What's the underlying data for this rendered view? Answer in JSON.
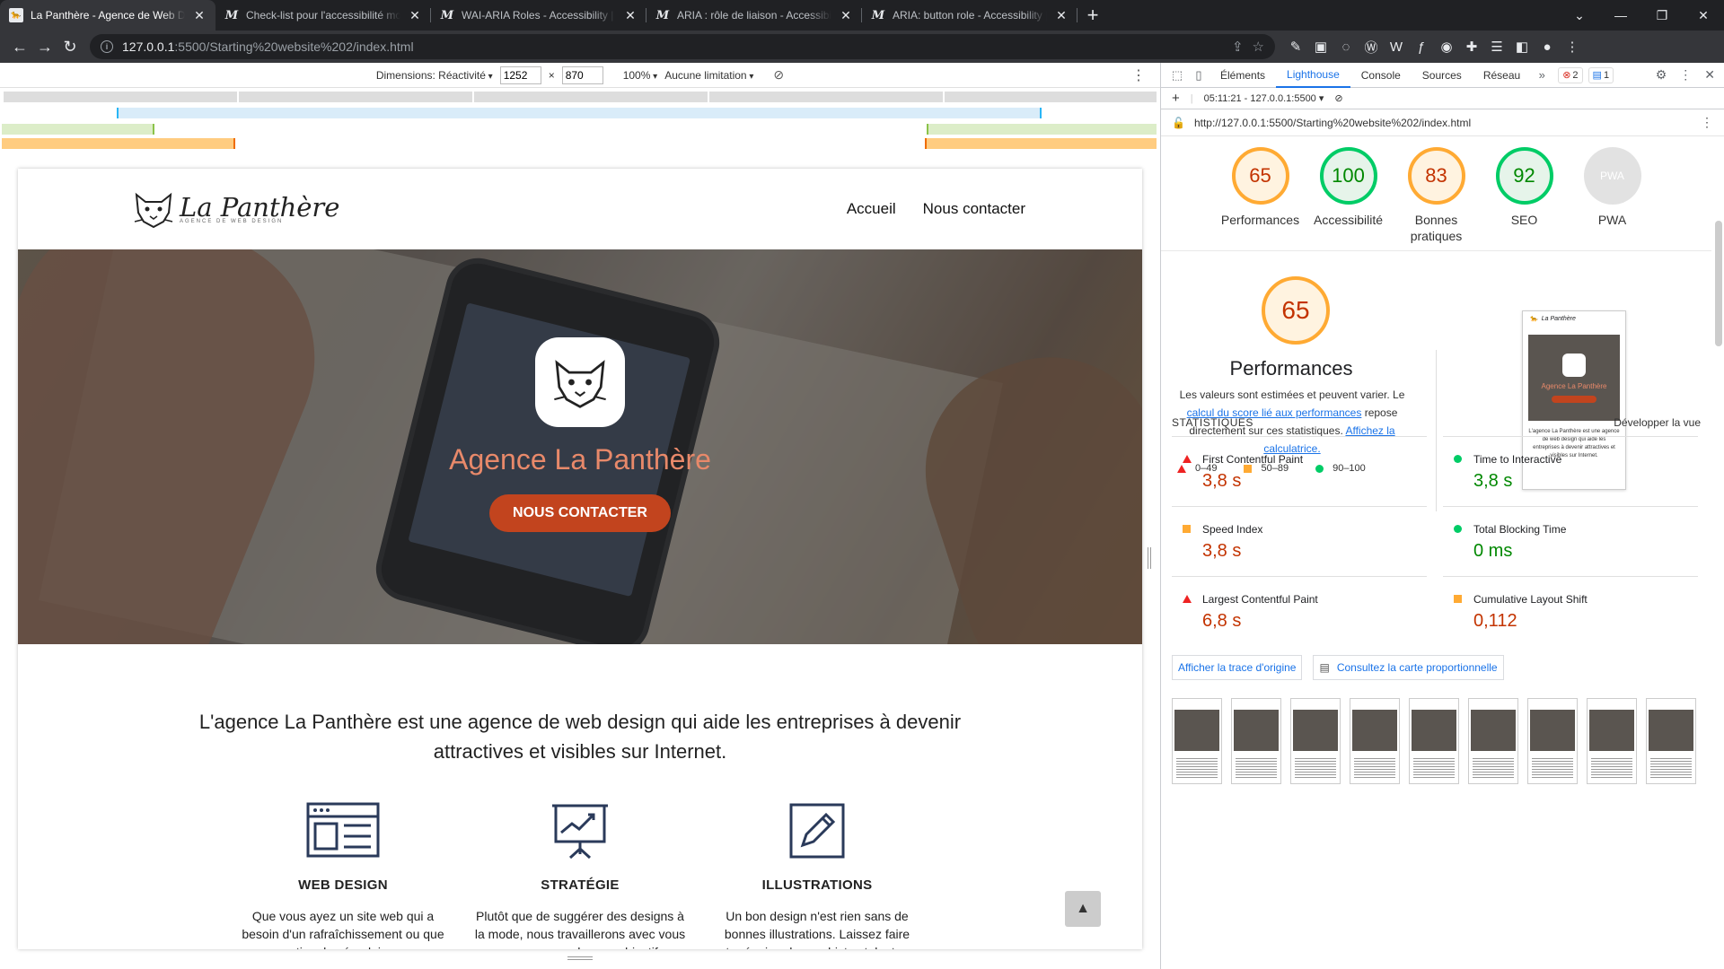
{
  "tabs": [
    {
      "title": "La Panthère - Agence de Web Design",
      "active": true
    },
    {
      "title": "Check-list pour l'accessibilité mobile"
    },
    {
      "title": "WAI-ARIA Roles - Accessibility | MDN"
    },
    {
      "title": "ARIA : rôle de liaison - Accessibilité"
    },
    {
      "title": "ARIA: button role - Accessibility | MDN"
    }
  ],
  "address": {
    "host": "127.0.0.1",
    "path": ":5500/Starting%20website%202/index.html"
  },
  "device_toolbar": {
    "dimensions_label": "Dimensions: Réactivité",
    "width": "1252",
    "times": "×",
    "height": "870",
    "zoom": "100%",
    "throttle": "Aucune limitation"
  },
  "site": {
    "logo_name": "La Panthère",
    "logo_sub": "AGENCE DE WEB DESIGN",
    "nav": [
      "Accueil",
      "Nous contacter"
    ],
    "hero_title": "Agence La Panthère",
    "hero_cta": "NOUS CONTACTER",
    "intro": "L'agence La Panthère est une agence de web design qui aide les entreprises à devenir attractives et visibles sur Internet.",
    "services": [
      {
        "title": "WEB DESIGN",
        "text": "Que vous ayez un site web qui a besoin d'un rafraîchissement ou que vous partiez de zéro, laissez-nous"
      },
      {
        "title": "STRATÉGIE",
        "text": "Plutôt que de suggérer des designs à la mode, nous travaillerons avec vous pour comprendre vos objectifs"
      },
      {
        "title": "ILLUSTRATIONS",
        "text": "Un bon design n'est rien sans de bonnes illustrations. Laissez faire notre équipe de graphistes talentueux"
      }
    ]
  },
  "devtools": {
    "tabs": [
      "Éléments",
      "Lighthouse",
      "Console",
      "Sources",
      "Réseau"
    ],
    "active_tab": "Lighthouse",
    "errors": "2",
    "messages": "1",
    "report_time": "05:11:21 - 127.0.0.1:5500",
    "report_url": "http://127.0.0.1:5500/Starting%20website%202/index.html"
  },
  "lighthouse": {
    "scores": [
      {
        "label": "Performances",
        "value": "65",
        "status": "orange"
      },
      {
        "label": "Accessibilité",
        "value": "100",
        "status": "green"
      },
      {
        "label": "Bonnes pratiques",
        "value": "83",
        "status": "orange"
      },
      {
        "label": "SEO",
        "value": "92",
        "status": "green"
      },
      {
        "label": "PWA",
        "value": "",
        "status": "gray"
      }
    ],
    "perf_score": "65",
    "perf_title": "Performances",
    "perf_desc_1": "Les valeurs sont estimées et peuvent varier. Le ",
    "perf_link_1": "calcul du score lié aux performances",
    "perf_desc_2": " repose directement sur ces statistiques. ",
    "perf_link_2": "Affichez la calculatrice.",
    "legend": [
      "0–49",
      "50–89",
      "90–100"
    ],
    "stats_heading": "STATISTIQUES",
    "expand": "Développer la vue",
    "metrics": [
      {
        "name": "First Contentful Paint",
        "value": "3,8 s",
        "status": "red"
      },
      {
        "name": "Time to Interactive",
        "value": "3,8 s",
        "status": "green"
      },
      {
        "name": "Speed Index",
        "value": "3,8 s",
        "status": "orange"
      },
      {
        "name": "Total Blocking Time",
        "value": "0 ms",
        "status": "green"
      },
      {
        "name": "Largest Contentful Paint",
        "value": "6,8 s",
        "status": "red"
      },
      {
        "name": "Cumulative Layout Shift",
        "value": "0,112",
        "status": "orange"
      }
    ],
    "btn_trace": "Afficher la trace d'origine",
    "btn_treemap": "Consultez la carte proportionnelle",
    "thumb_title": "La Panthère",
    "thumb_hero": "Agence La Panthère",
    "thumb_cta": "NOUS CONTACTER",
    "thumb_text": "L'agence La Panthère est une agence de web design qui aide les entreprises à devenir attractives et visibles sur Internet.",
    "filmstrip_count": 9
  },
  "colors": {
    "accent": "#1a73e8",
    "cta": "#c2441e",
    "orange": "#ffaa33",
    "green": "#00cc66",
    "red": "#c33300"
  }
}
